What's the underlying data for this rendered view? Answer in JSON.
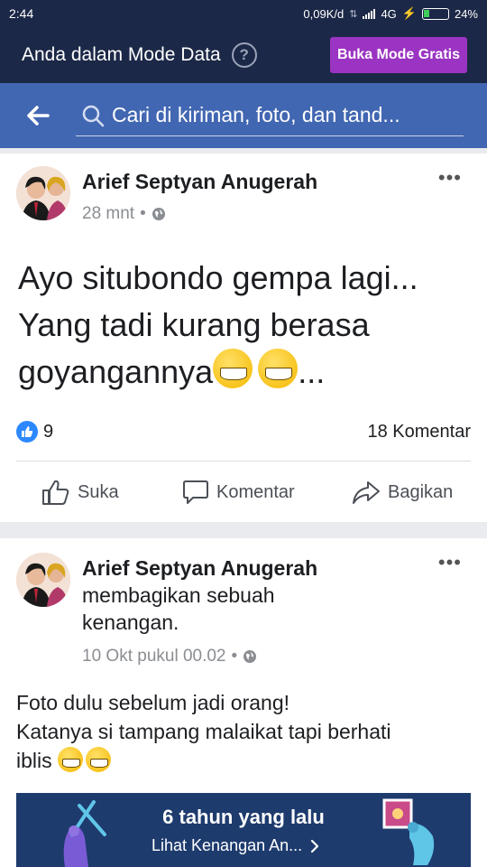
{
  "status_bar": {
    "time": "2:44",
    "speed": "0,09K/d",
    "network": "4G",
    "battery": "24%"
  },
  "data_mode": {
    "label": "Anda dalam Mode Data",
    "help": "?",
    "button": "Buka Mode Gratis"
  },
  "search": {
    "placeholder": "Cari di kiriman, foto, dan tand..."
  },
  "posts": [
    {
      "author": "Arief Septyan Anugerah",
      "time": "28 mnt",
      "text_lines": [
        "Ayo situbondo gempa lagi...",
        "Yang tadi kurang berasa",
        "goyangannya"
      ],
      "text_suffix": "...",
      "likes": "9",
      "comments": "18 Komentar",
      "actions": {
        "like": "Suka",
        "comment": "Komentar",
        "share": "Bagikan"
      }
    },
    {
      "author": "Arief Septyan Anugerah",
      "shared_line1": "membagikan sebuah",
      "shared_line2": "kenangan.",
      "time": "10 Okt pukul 00.02",
      "text_line1": "Foto dulu sebelum jadi orang!",
      "text_line2": "Katanya si tampang malaikat tapi berhati",
      "text_line3": "iblis",
      "memory": {
        "title": "6 tahun yang lalu",
        "link": "Lihat Kenangan An..."
      }
    }
  ],
  "colors": {
    "status_bg": "#1c2847",
    "search_bg": "#4267b2",
    "free_button": "#9b34c2",
    "like_blue": "#2d88ff",
    "memory_bg": "#1e3b6e"
  },
  "icons": [
    "back-arrow-icon",
    "search-icon",
    "help-icon",
    "more-icon",
    "globe-icon",
    "like-icon",
    "comment-icon",
    "share-icon",
    "grin-emoji-icon"
  ]
}
